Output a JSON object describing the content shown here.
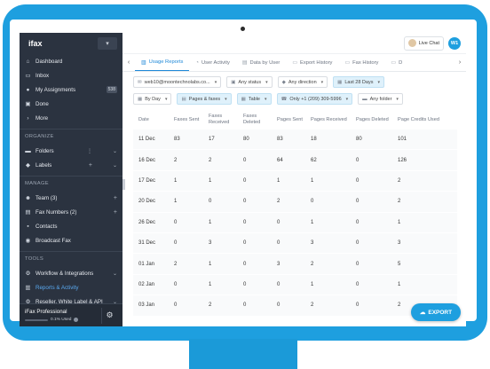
{
  "app": {
    "logo": "ifax",
    "toggle_icon": "chevron-down-icon"
  },
  "sidebar": {
    "items": [
      {
        "label": "Dashboard",
        "icon": "home-icon"
      },
      {
        "label": "Inbox",
        "icon": "inbox-icon"
      },
      {
        "label": "My Assignments",
        "icon": "user-icon",
        "badge": "538"
      },
      {
        "label": "Done",
        "icon": "done-icon"
      },
      {
        "label": "More",
        "icon": "chevron-right-icon"
      }
    ],
    "organize_title": "ORGANIZE",
    "organize": [
      {
        "label": "Folders",
        "icon": "folder-icon"
      },
      {
        "label": "Labels",
        "icon": "tag-icon"
      }
    ],
    "manage_title": "MANAGE",
    "manage": [
      {
        "label": "Team (3)",
        "icon": "team-icon"
      },
      {
        "label": "Fax Numbers (2)",
        "icon": "fax-icon"
      },
      {
        "label": "Contacts",
        "icon": "contacts-icon"
      },
      {
        "label": "Broadcast Fax",
        "icon": "broadcast-icon"
      }
    ],
    "tools_title": "TOOLS",
    "tools": [
      {
        "label": "Workflow & Integrations",
        "icon": "workflow-icon"
      },
      {
        "label": "Reports & Activity",
        "icon": "reports-icon",
        "active": true
      },
      {
        "label": "Reseller, White Label & API",
        "icon": "api-icon"
      }
    ],
    "plan": {
      "name": "iFax Professional",
      "used": "0.1% Used",
      "fraction": 0.001
    }
  },
  "topbar": {
    "live_chat": "Live Chat",
    "avatar_initials": "W1"
  },
  "tabs": [
    {
      "label": "Usage Reports",
      "active": true
    },
    {
      "label": "User Activity"
    },
    {
      "label": "Data by User"
    },
    {
      "label": "Export History"
    },
    {
      "label": "Fax History"
    },
    {
      "label": "D"
    }
  ],
  "filters": {
    "row1": [
      {
        "label": "web10@moontechnolabs.co...",
        "icon": "envelope-icon",
        "highlight": false
      },
      {
        "label": "Any status",
        "icon": "status-icon",
        "highlight": false
      },
      {
        "label": "Any direction",
        "icon": "direction-icon",
        "highlight": false
      },
      {
        "label": "Last 28 Days",
        "icon": "calendar-icon",
        "highlight": true
      }
    ],
    "row2": [
      {
        "label": "By Day",
        "icon": "calendar-icon",
        "highlight": false
      },
      {
        "label": "Pages & faxes",
        "icon": "pages-icon",
        "highlight": true
      },
      {
        "label": "Table",
        "icon": "table-icon",
        "highlight": true
      },
      {
        "label": "Only +1 (209) 309-5996",
        "icon": "phone-icon",
        "highlight": true
      },
      {
        "label": "Any folder",
        "icon": "folder-icon",
        "highlight": false
      }
    ]
  },
  "table": {
    "headers": [
      "Date",
      "Faxes Sent",
      "Faxes Received",
      "Faxes Deleted",
      "Pages Sent",
      "Pages Received",
      "Pages Deleted",
      "Page Credits Used"
    ],
    "rows": [
      [
        "11 Dec",
        "83",
        "17",
        "80",
        "83",
        "18",
        "80",
        "101"
      ],
      [
        "16 Dec",
        "2",
        "2",
        "0",
        "64",
        "62",
        "0",
        "126"
      ],
      [
        "17 Dec",
        "1",
        "1",
        "0",
        "1",
        "1",
        "0",
        "2"
      ],
      [
        "20 Dec",
        "1",
        "0",
        "0",
        "2",
        "0",
        "0",
        "2"
      ],
      [
        "26 Dec",
        "0",
        "1",
        "0",
        "0",
        "1",
        "0",
        "1"
      ],
      [
        "31 Dec",
        "0",
        "3",
        "0",
        "0",
        "3",
        "0",
        "3"
      ],
      [
        "01 Jan",
        "2",
        "1",
        "0",
        "3",
        "2",
        "0",
        "5"
      ],
      [
        "02 Jan",
        "0",
        "1",
        "0",
        "0",
        "1",
        "0",
        "1"
      ],
      [
        "03 Jan",
        "0",
        "2",
        "0",
        "0",
        "2",
        "0",
        "2"
      ]
    ]
  },
  "export_label": "EXPORT",
  "colors": {
    "accent": "#1e9fdf",
    "sidebar_bg": "#2b3340",
    "active_link": "#5aa9f0"
  }
}
